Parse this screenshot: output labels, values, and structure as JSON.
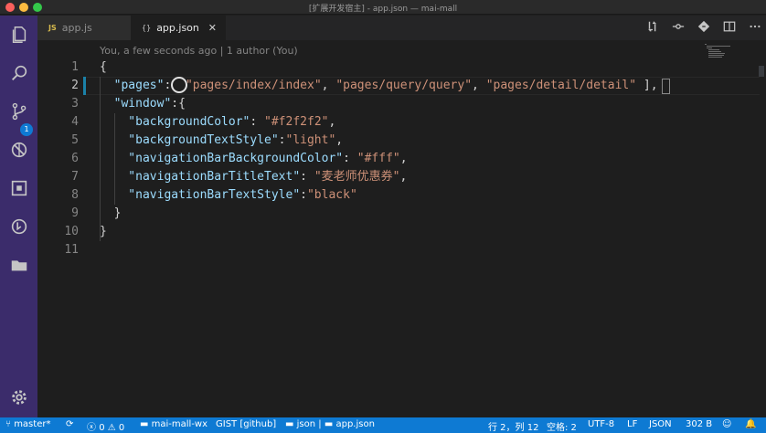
{
  "window": {
    "title": "[扩展开发宿主] - app.json — mai-mall"
  },
  "activity_bar": {
    "icons": [
      "files-icon",
      "search-icon",
      "source-control-icon",
      "debug-icon",
      "extensions-icon",
      "timeline-icon",
      "folder-icon",
      "settings-gear-icon"
    ],
    "scm_badge": "1"
  },
  "tabs": [
    {
      "icon": "JS",
      "label": "app.js",
      "active": false
    },
    {
      "icon": "{}",
      "label": "app.json",
      "active": true,
      "close": "✕"
    }
  ],
  "editor_toolbar": [
    "open-changes-icon",
    "go-back-icon",
    "git-compare-icon",
    "split-editor-icon",
    "more-actions-icon"
  ],
  "codelens": "You, a few seconds ago | 1 author (You)",
  "editor": {
    "active_line": 2,
    "lines": [
      {
        "n": "1",
        "tokens": [
          [
            "p",
            "{"
          ]
        ]
      },
      {
        "n": "2",
        "tokens": [
          [
            "k",
            "  \"pages\""
          ],
          [
            "p",
            ":  "
          ],
          [
            "s",
            "\"pages/index/index\""
          ],
          [
            "p",
            ", "
          ],
          [
            "s",
            "\"pages/query/query\""
          ],
          [
            "p",
            ", "
          ],
          [
            "s",
            "\"pages/detail/detail\""
          ],
          [
            "p",
            " ],"
          ]
        ]
      },
      {
        "n": "3",
        "tokens": [
          [
            "k",
            "  \"window\""
          ],
          [
            "p",
            ":{"
          ]
        ]
      },
      {
        "n": "4",
        "tokens": [
          [
            "k",
            "    \"backgroundColor\""
          ],
          [
            "p",
            ": "
          ],
          [
            "s",
            "\"#f2f2f2\""
          ],
          [
            "p",
            ","
          ]
        ]
      },
      {
        "n": "5",
        "tokens": [
          [
            "k",
            "    \"backgroundTextStyle\""
          ],
          [
            "p",
            ":"
          ],
          [
            "s",
            "\"light\""
          ],
          [
            "p",
            ","
          ]
        ]
      },
      {
        "n": "6",
        "tokens": [
          [
            "k",
            "    \"navigationBarBackgroundColor\""
          ],
          [
            "p",
            ": "
          ],
          [
            "s",
            "\"#fff\""
          ],
          [
            "p",
            ","
          ]
        ]
      },
      {
        "n": "7",
        "tokens": [
          [
            "k",
            "    \"navigationBarTitleText\""
          ],
          [
            "p",
            ": "
          ],
          [
            "s",
            "\"麦老师优惠券\""
          ],
          [
            "p",
            ","
          ]
        ]
      },
      {
        "n": "8",
        "tokens": [
          [
            "k",
            "    \"navigationBarTextStyle\""
          ],
          [
            "p",
            ":"
          ],
          [
            "s",
            "\"black\""
          ]
        ]
      },
      {
        "n": "9",
        "tokens": [
          [
            "p",
            "  }"
          ]
        ]
      },
      {
        "n": "10",
        "tokens": [
          [
            "p",
            "}"
          ]
        ]
      },
      {
        "n": "11",
        "tokens": []
      }
    ]
  },
  "statusbar": {
    "branch": "master*",
    "sync": "⟳",
    "errors": "0",
    "warnings": "0",
    "project": "mai-mall-wx",
    "gist": "GIST [github]",
    "breadcrumb": [
      "json",
      "app.json"
    ],
    "position": "行 2，列 12",
    "indent": "空格: 2",
    "encoding": "UTF-8",
    "eol": "LF",
    "language": "JSON",
    "size": "302 B"
  },
  "colors": {
    "activity_bar": "#3b2c6b",
    "status_bar": "#0e7ad3",
    "editor_bg": "#1e1e1e",
    "key": "#9cdcfe",
    "string": "#ce9178"
  }
}
